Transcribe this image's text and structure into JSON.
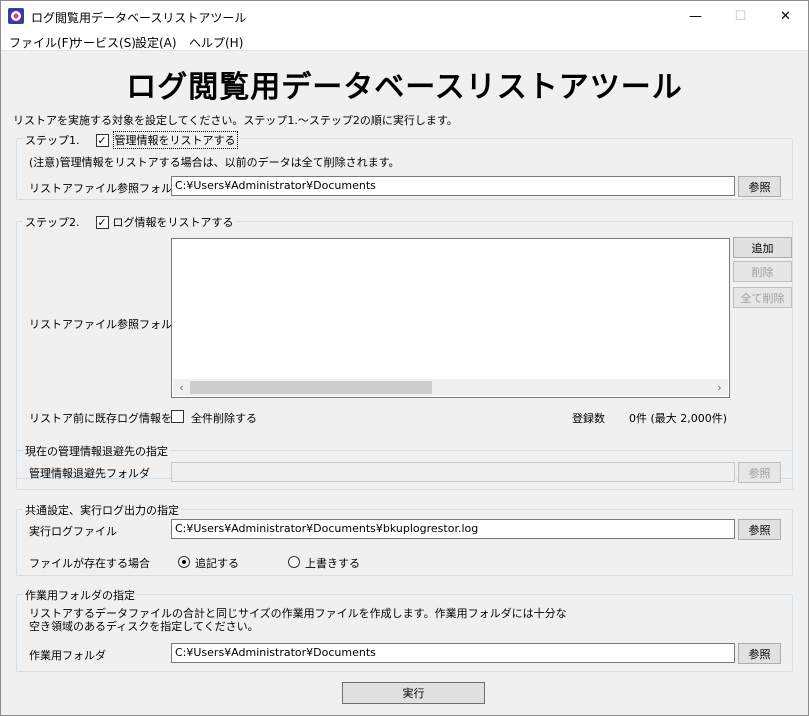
{
  "window": {
    "title": "ログ閲覧用データベースリストアツール",
    "minimize": "—",
    "maximize": "☐",
    "close": "✕"
  },
  "menu": [
    "ファイル(F)",
    "サービス(S)",
    "設定(A)",
    "ヘルプ(H)"
  ],
  "header": {
    "title": "ログ閲覧用データベースリストアツール",
    "instruction": "リストアを実施する対象を設定してください。ステップ1.〜ステップ2の順に実行します。"
  },
  "step1": {
    "label": "ステップ1.",
    "checkbox_label": "管理情報をリストアする",
    "checked": true,
    "note": "(注意)管理情報をリストアする場合は、以前のデータは全て削除されます。",
    "folder_label": "リストアファイル参照フォルダ",
    "folder_value": "C:¥Users¥Administrator¥Documents",
    "browse": "参照"
  },
  "step2": {
    "label": "ステップ2.",
    "checkbox_label": "ログ情報をリストアする",
    "checked": true,
    "folder_label": "リストアファイル参照フォルダ",
    "add": "追加",
    "remove": "削除",
    "remove_all": "全て削除",
    "delete_label": "リストア前に既存ログ情報を",
    "delete_all_label": "全件削除する",
    "count_label": "登録数",
    "count_value": "0件 (最大 2,000件)",
    "scroll_left": "‹",
    "scroll_right": "›"
  },
  "backup": {
    "title": "現在の管理情報退避先の指定",
    "folder_label": "管理情報退避先フォルダ",
    "folder_value": "",
    "browse": "参照"
  },
  "common": {
    "title": "共通設定、実行ログ出力の指定",
    "log_label": "実行ログファイル",
    "log_value": "C:¥Users¥Administrator¥Documents¥bkuplogrestor.log",
    "browse": "参照",
    "exists_label": "ファイルが存在する場合",
    "append": "追記する",
    "overwrite": "上書きする"
  },
  "work": {
    "title": "作業用フォルダの指定",
    "desc1": "リストアするデータファイルの合計と同じサイズの作業用ファイルを作成します。作業用フォルダには十分な",
    "desc2": "空き領域のあるディスクを指定してください。",
    "folder_label": "作業用フォルダ",
    "folder_value": "C:¥Users¥Administrator¥Documents",
    "browse": "参照"
  },
  "execute": "実行"
}
